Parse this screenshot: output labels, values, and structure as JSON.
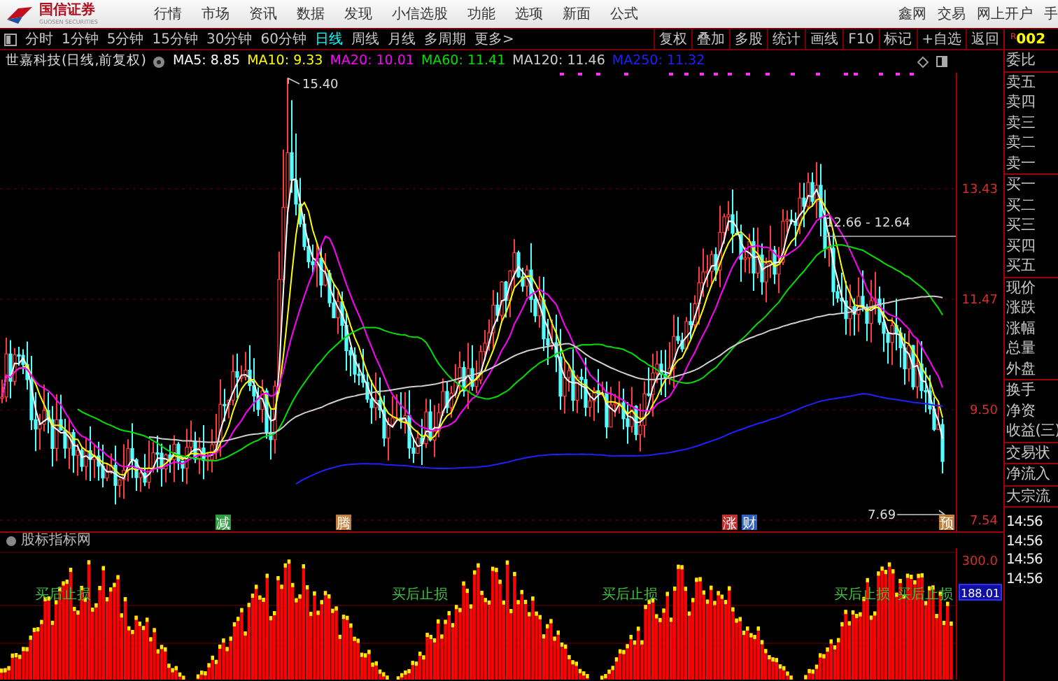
{
  "header": {
    "logo": {
      "name": "国信证券",
      "subtitle": "GUOSEN SECURITIES"
    },
    "menu": [
      "行情",
      "市场",
      "资讯",
      "数据",
      "发现",
      "小信选股",
      "功能",
      "选项",
      "新面",
      "公式"
    ],
    "links": [
      "鑫网",
      "交易",
      "网上开户",
      "手"
    ]
  },
  "toolbar": {
    "periods": [
      {
        "label": "分时",
        "selected": false
      },
      {
        "label": "1分钟",
        "selected": false
      },
      {
        "label": "5分钟",
        "selected": false
      },
      {
        "label": "15分钟",
        "selected": false
      },
      {
        "label": "30分钟",
        "selected": false
      },
      {
        "label": "60分钟",
        "selected": false
      },
      {
        "label": "日线",
        "selected": true
      },
      {
        "label": "周线",
        "selected": false
      },
      {
        "label": "月线",
        "selected": false
      },
      {
        "label": "多周期",
        "selected": false
      },
      {
        "label": "更多>",
        "selected": false
      }
    ],
    "tools": [
      "复权",
      "叠加",
      "多股",
      "统计",
      "画线",
      "F10",
      "标记",
      "+自选",
      "返回"
    ],
    "code": {
      "prefix": "R",
      "value": "002"
    }
  },
  "chart": {
    "title": "世嘉科技(日线,前复权)",
    "moving_averages": [
      {
        "label": "MA5: 8.85",
        "color": "#ffffff"
      },
      {
        "label": "MA10: 9.33",
        "color": "#ffff00"
      },
      {
        "label": "MA20: 10.01",
        "color": "#ff00ff"
      },
      {
        "label": "MA60: 11.41",
        "color": "#00e000"
      },
      {
        "label": "MA120: 11.46",
        "color": "#d0d0d0"
      },
      {
        "label": "MA250: 11.32",
        "color": "#2020ff"
      }
    ],
    "price_axis": [
      "13.43",
      "11.47",
      "9.50",
      "7.54"
    ],
    "annotations": {
      "high": "15.40",
      "range": "12.66 - 12.64",
      "low": "7.69"
    },
    "markers": [
      {
        "label": "减",
        "color": "#2e9e3e"
      },
      {
        "label": "腾",
        "color": "#c08040"
      },
      {
        "label": "涨",
        "color": "#c03030"
      },
      {
        "label": "财",
        "color": "#3060c0"
      },
      {
        "label": "预",
        "color": "#c08040"
      }
    ]
  },
  "indicator": {
    "title": "股标指标网",
    "axis": [
      "300.0"
    ],
    "current_value": "188.01",
    "signals": [
      "买后止损",
      "买后止损",
      "买后止损",
      "买后止损",
      "买后止损"
    ]
  },
  "quote_panel": {
    "groups": [
      [
        "委比"
      ],
      [
        "卖五",
        "卖四",
        "卖三",
        "卖二",
        "卖一"
      ],
      [
        "买一",
        "买二",
        "买三",
        "买四",
        "买五"
      ],
      [
        "现价",
        "涨跌",
        "涨幅",
        "总量",
        "外盘"
      ],
      [
        "换手",
        "净资",
        "收益(三)"
      ],
      [
        "交易状"
      ],
      [
        "净流入"
      ],
      [
        "大宗流"
      ]
    ],
    "times": [
      "14:56",
      "14:56",
      "14:56",
      "14:56"
    ]
  }
}
